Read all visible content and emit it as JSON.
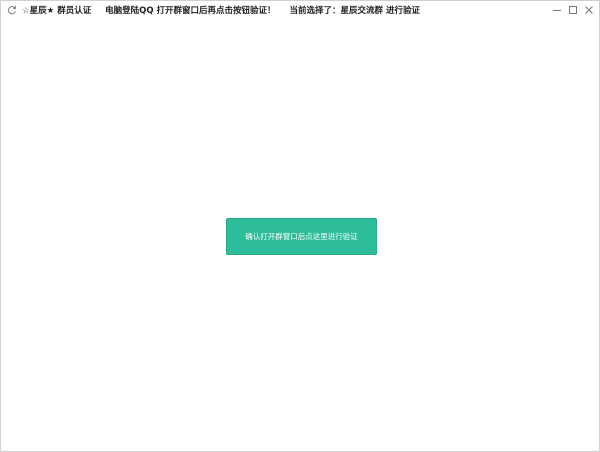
{
  "titlebar": {
    "app_icon": "refresh-icon",
    "segments": [
      "☆星辰★ 群员认证",
      "电脑登陆QQ 打开群窗口后再点击按钮验证！",
      "当前选择了：星辰交流群 进行验证"
    ],
    "controls": [
      "minimize-icon",
      "maximize-icon",
      "close-icon"
    ]
  },
  "main": {
    "verify_button_label": "确认打开群窗口后点这里进行验证"
  },
  "colors": {
    "accent": "#2dbd9b",
    "window_border": "#d0d0d0"
  }
}
